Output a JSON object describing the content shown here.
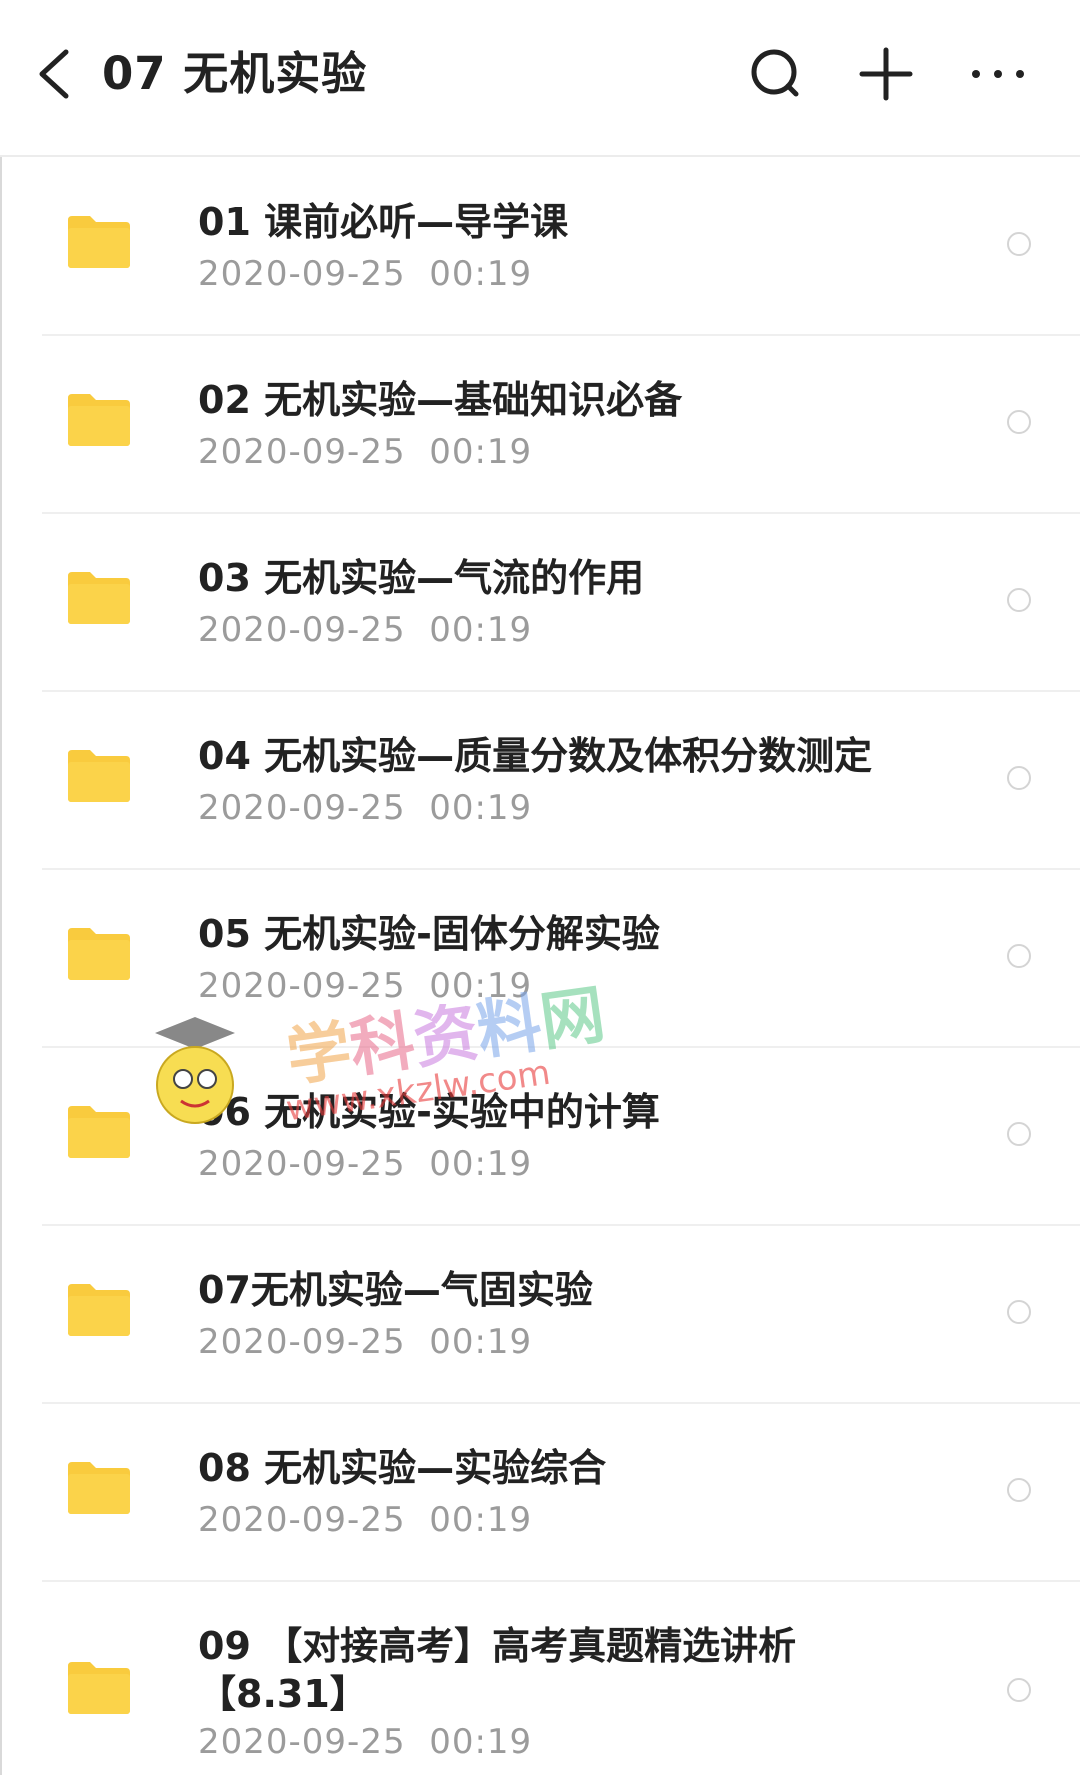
{
  "header": {
    "title": "07 无机实验",
    "icons": {
      "back": "back-chevron-icon",
      "search": "search-icon",
      "add": "plus-icon",
      "more": "more-dots-icon"
    }
  },
  "colors": {
    "folder": "#f9cb3e",
    "folder_tab": "#f5c12c",
    "name": "#222222",
    "date": "#9b9b9b",
    "divider": "#efefef"
  },
  "files": [
    {
      "name": "01 课前必听—导学课",
      "date": "2020-09-25  00:19"
    },
    {
      "name": "02 无机实验—基础知识必备",
      "date": "2020-09-25  00:19"
    },
    {
      "name": "03 无机实验—气流的作用",
      "date": "2020-09-25  00:19"
    },
    {
      "name": "04 无机实验—质量分数及体积分数测定",
      "date": "2020-09-25  00:19"
    },
    {
      "name": "05 无机实验-固体分解实验",
      "date": "2020-09-25  00:19"
    },
    {
      "name": "06 无机实验-实验中的计算",
      "date": "2020-09-25  00:19"
    },
    {
      "name": "07无机实验—气固实验",
      "date": "2020-09-25  00:19"
    },
    {
      "name": "08 无机实验—实验综合",
      "date": "2020-09-25  00:19"
    },
    {
      "name": "09 【对接高考】高考真题精选讲析【8.31】",
      "date": "2020-09-25  00:19"
    }
  ],
  "watermark": {
    "text": "学科资料网",
    "url": "www.xkzlw.com"
  }
}
